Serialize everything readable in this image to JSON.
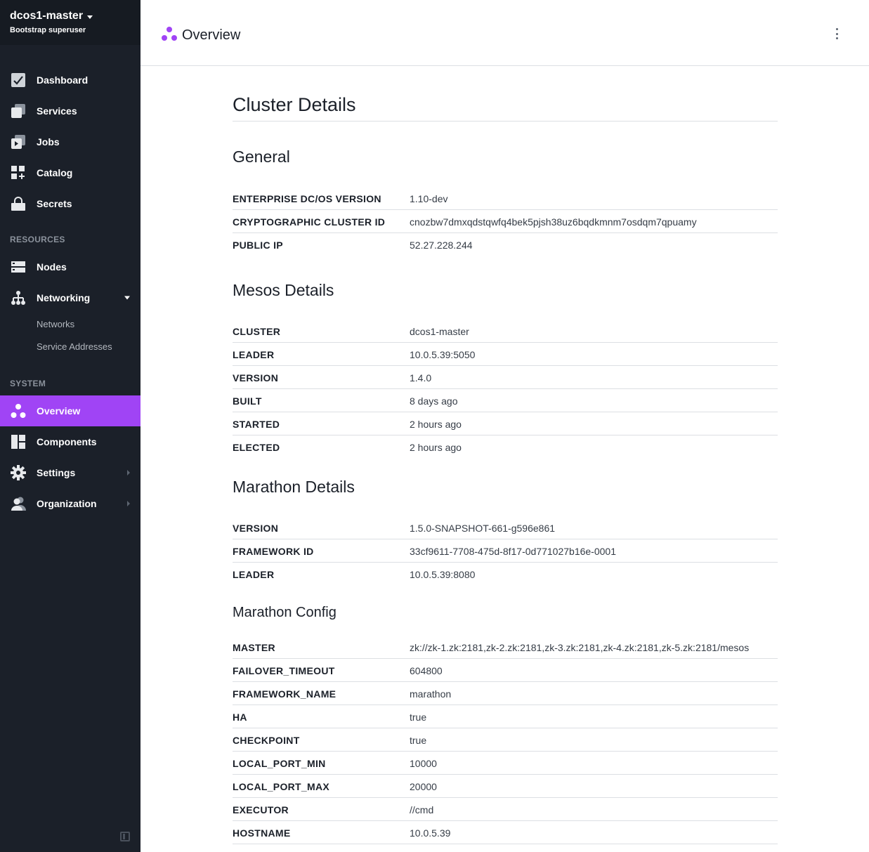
{
  "sidebar": {
    "cluster_name": "dcos1-master",
    "cluster_user": "Bootstrap superuser",
    "items": [
      {
        "label": "Dashboard",
        "icon": "dashboard-icon"
      },
      {
        "label": "Services",
        "icon": "services-icon"
      },
      {
        "label": "Jobs",
        "icon": "jobs-icon"
      },
      {
        "label": "Catalog",
        "icon": "catalog-icon"
      },
      {
        "label": "Secrets",
        "icon": "secrets-icon"
      }
    ],
    "resources_label": "RESOURCES",
    "resources": [
      {
        "label": "Nodes",
        "icon": "nodes-icon"
      },
      {
        "label": "Networking",
        "icon": "networking-icon"
      }
    ],
    "networking_sub": [
      "Networks",
      "Service Addresses"
    ],
    "system_label": "SYSTEM",
    "system": [
      {
        "label": "Overview",
        "icon": "overview-icon",
        "active": true
      },
      {
        "label": "Components",
        "icon": "components-icon"
      },
      {
        "label": "Settings",
        "icon": "settings-icon"
      },
      {
        "label": "Organization",
        "icon": "organization-icon"
      }
    ],
    "accent_color": "#a044f5"
  },
  "header": {
    "title": "Overview"
  },
  "main": {
    "title": "Cluster Details",
    "general": {
      "heading": "General",
      "rows": [
        {
          "key": "ENTERPRISE DC/OS VERSION",
          "value": "1.10-dev"
        },
        {
          "key": "CRYPTOGRAPHIC CLUSTER ID",
          "value": "cnozbw7dmxqdstqwfq4bek5pjsh38uz6bqdkmnm7osdqm7qpuamy"
        },
        {
          "key": "PUBLIC IP",
          "value": "52.27.228.244"
        }
      ]
    },
    "mesos": {
      "heading": "Mesos Details",
      "rows": [
        {
          "key": "CLUSTER",
          "value": "dcos1-master"
        },
        {
          "key": "LEADER",
          "value": "10.0.5.39:5050"
        },
        {
          "key": "VERSION",
          "value": "1.4.0"
        },
        {
          "key": "BUILT",
          "value": "8 days ago"
        },
        {
          "key": "STARTED",
          "value": "2 hours ago"
        },
        {
          "key": "ELECTED",
          "value": "2 hours ago"
        }
      ]
    },
    "marathon": {
      "heading": "Marathon Details",
      "rows": [
        {
          "key": "VERSION",
          "value": "1.5.0-SNAPSHOT-661-g596e861"
        },
        {
          "key": "FRAMEWORK ID",
          "value": "33cf9611-7708-475d-8f17-0d771027b16e-0001"
        },
        {
          "key": "LEADER",
          "value": "10.0.5.39:8080"
        }
      ]
    },
    "marathon_config": {
      "heading": "Marathon Config",
      "rows": [
        {
          "key": "MASTER",
          "value": "zk://zk-1.zk:2181,zk-2.zk:2181,zk-3.zk:2181,zk-4.zk:2181,zk-5.zk:2181/mesos"
        },
        {
          "key": "FAILOVER_TIMEOUT",
          "value": "604800"
        },
        {
          "key": "FRAMEWORK_NAME",
          "value": "marathon"
        },
        {
          "key": "HA",
          "value": "true"
        },
        {
          "key": "CHECKPOINT",
          "value": "true"
        },
        {
          "key": "LOCAL_PORT_MIN",
          "value": "10000"
        },
        {
          "key": "LOCAL_PORT_MAX",
          "value": "20000"
        },
        {
          "key": "EXECUTOR",
          "value": "//cmd"
        },
        {
          "key": "HOSTNAME",
          "value": "10.0.5.39"
        }
      ]
    }
  }
}
